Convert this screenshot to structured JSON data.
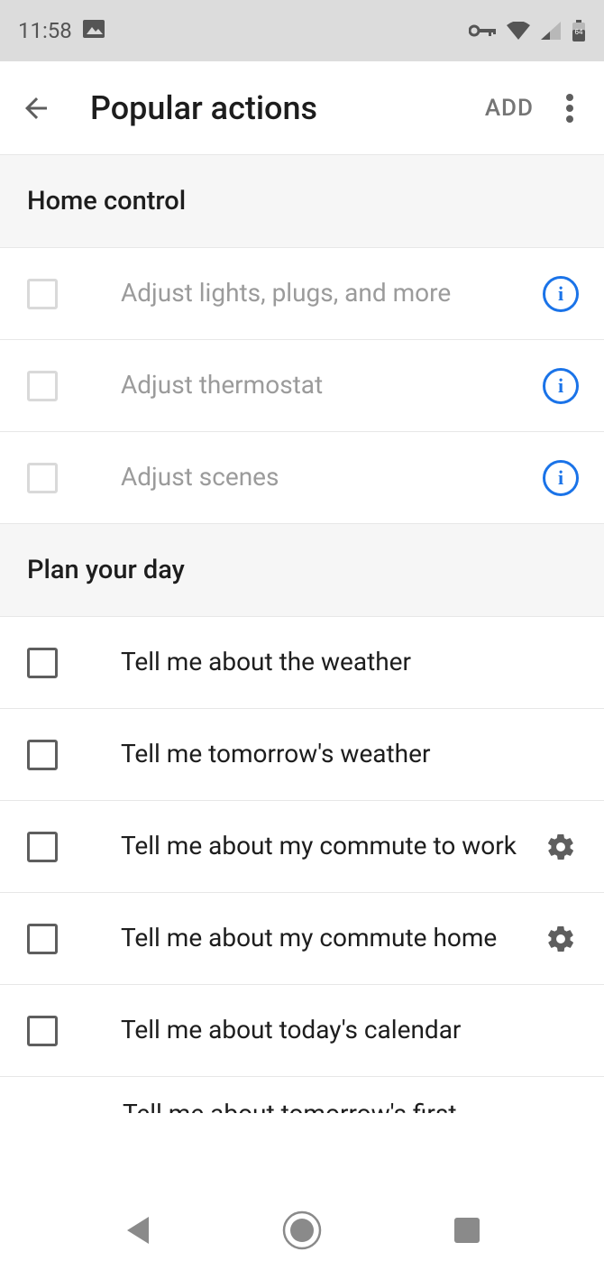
{
  "status_bar": {
    "time": "11:58",
    "battery_text": "64"
  },
  "app_bar": {
    "title": "Popular actions",
    "add_label": "ADD"
  },
  "sections": {
    "home_control": {
      "title": "Home control",
      "items": [
        {
          "label": "Adjust lights, plugs, and more"
        },
        {
          "label": "Adjust thermostat"
        },
        {
          "label": "Adjust scenes"
        }
      ]
    },
    "plan_day": {
      "title": "Plan your day",
      "items": [
        {
          "label": "Tell me about the weather"
        },
        {
          "label": "Tell me tomorrow's weather"
        },
        {
          "label": "Tell me about my commute to work"
        },
        {
          "label": "Tell me about my commute home"
        },
        {
          "label": "Tell me about today's calendar"
        },
        {
          "label": "Tell me about tomorrow's first"
        }
      ]
    }
  }
}
